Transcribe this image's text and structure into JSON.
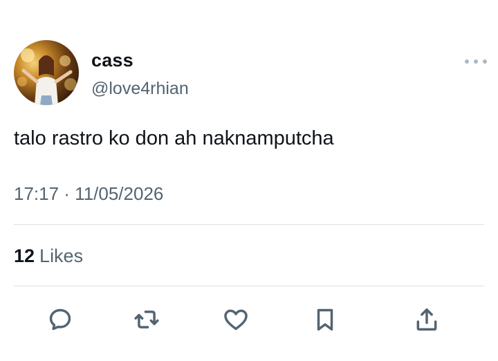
{
  "tweet": {
    "display_name": "cass",
    "handle": "@love4rhian",
    "text": "talo rastro ko don ah naknamputcha",
    "timestamp": "17:17 · 11/05/2026",
    "likes_count": "12",
    "likes_label": "Likes"
  },
  "icons": {
    "more": "more-horizontal-icon",
    "reply": "reply-icon",
    "retweet": "retweet-icon",
    "like": "heart-icon",
    "bookmark": "bookmark-icon",
    "share": "share-icon"
  },
  "colors": {
    "primary_text": "#0f1419",
    "secondary_text": "#536471",
    "divider": "#dcdfe2",
    "more_dots": "#aab8c2"
  }
}
